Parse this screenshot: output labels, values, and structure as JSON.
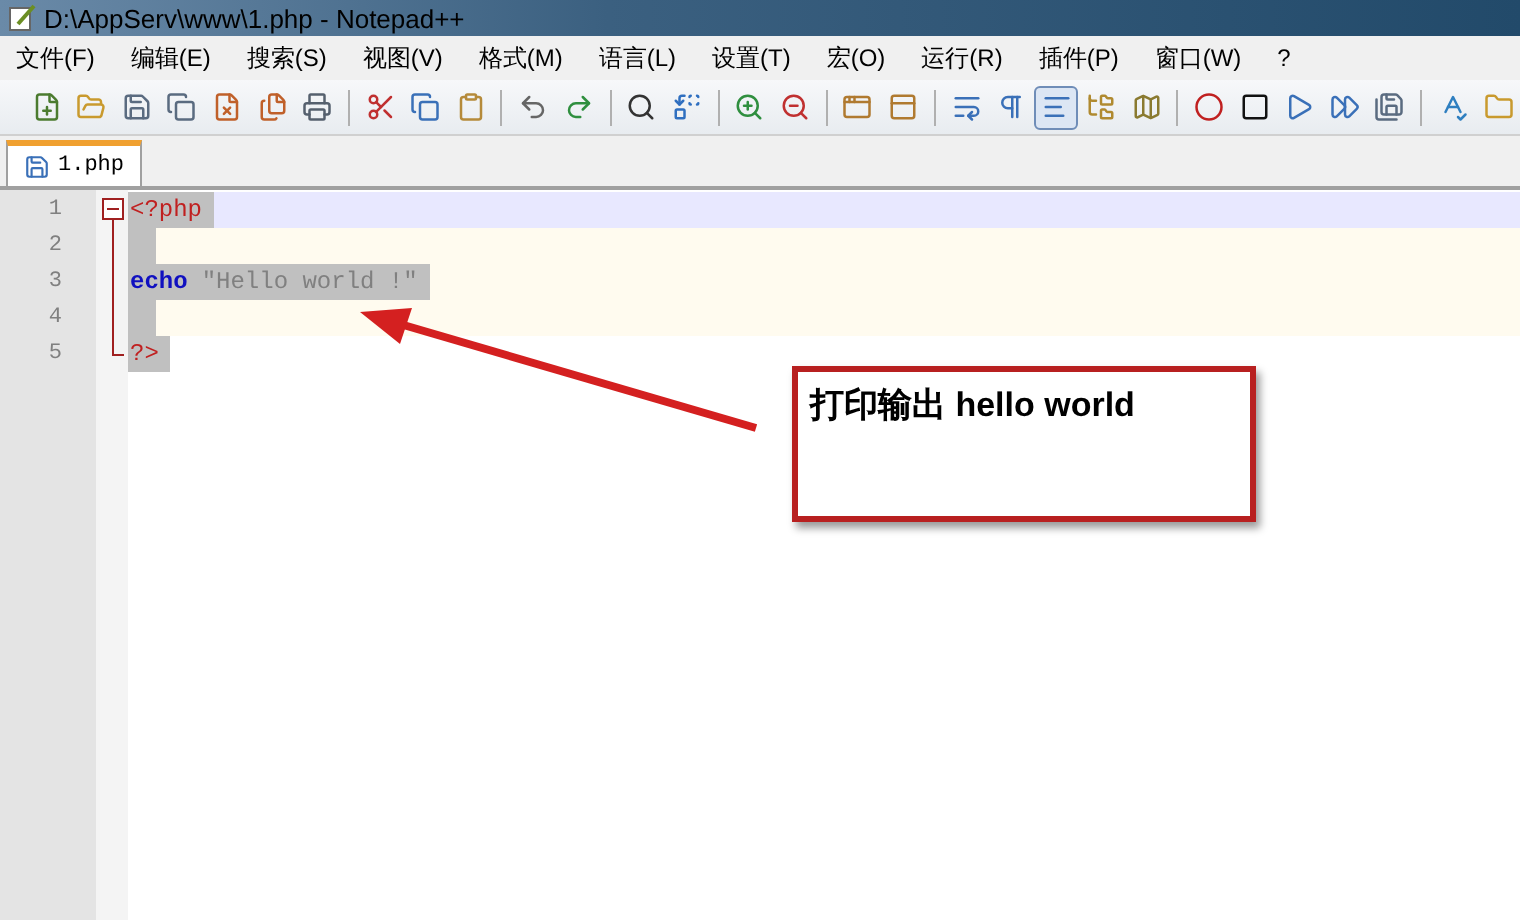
{
  "window": {
    "title": "D:\\AppServ\\www\\1.php - Notepad++"
  },
  "menu": [
    "文件(F)",
    "编辑(E)",
    "搜索(S)",
    "视图(V)",
    "格式(M)",
    "语言(L)",
    "设置(T)",
    "宏(O)",
    "运行(R)",
    "插件(P)",
    "窗口(W)",
    "?"
  ],
  "toolbar": [
    {
      "pressed": false
    },
    {
      "pressed": false
    },
    {
      "pressed": false
    },
    {
      "pressed": false
    },
    {
      "pressed": false
    },
    {
      "pressed": false
    },
    {
      "pressed": false
    },
    {
      "pressed": false
    },
    {
      "pressed": false
    },
    {
      "pressed": false
    },
    {
      "pressed": false
    },
    {
      "pressed": false
    },
    {
      "pressed": false
    },
    {
      "pressed": false
    },
    {
      "pressed": false
    },
    {
      "pressed": false
    },
    {
      "pressed": false
    },
    {
      "pressed": false
    },
    {
      "pressed": false
    },
    {
      "pressed": false
    },
    {
      "pressed": true
    },
    {
      "pressed": false
    },
    {
      "pressed": false
    },
    {
      "pressed": false
    },
    {
      "pressed": false
    },
    {
      "pressed": false
    },
    {
      "pressed": false
    },
    {
      "pressed": false
    },
    {
      "pressed": false
    },
    {
      "pressed": false
    }
  ],
  "tabs": [
    {
      "label": "1.php",
      "selected": true
    }
  ],
  "editor": {
    "lines": [
      {
        "number": "1",
        "current": true,
        "kind": "fold-start",
        "tokens": [
          {
            "kind": "tag",
            "text": "<?php"
          }
        ]
      },
      {
        "number": "2",
        "current": false,
        "kind": "fold-middle"
      },
      {
        "number": "3",
        "current": false,
        "kind": "fold-middle",
        "tokens": [
          {
            "kind": "keyword",
            "text": "echo"
          },
          {
            "kind": "string",
            "text": "\"Hello world !\""
          }
        ]
      },
      {
        "number": "4",
        "current": false,
        "kind": "fold-middle"
      },
      {
        "number": "5",
        "current": false,
        "kind": "fold-end",
        "tokens": [
          {
            "kind": "tag",
            "text": "?>"
          }
        ]
      }
    ]
  },
  "annotation": {
    "text": "打印输出 hello world"
  }
}
